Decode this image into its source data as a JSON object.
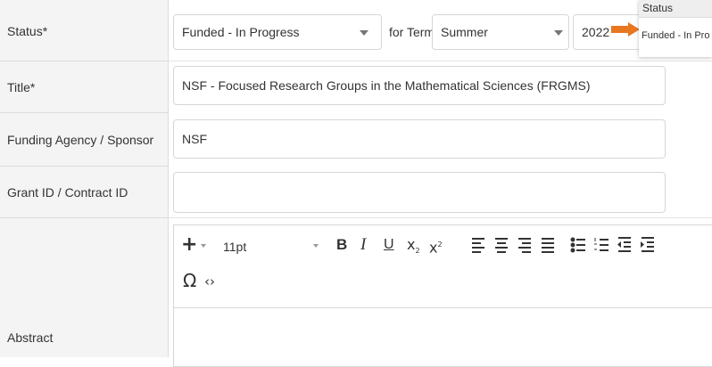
{
  "fields": {
    "status_label": "Status*",
    "title_label": "Title*",
    "funding_label": "Funding Agency / Sponsor",
    "grant_label": "Grant ID / Contract ID",
    "abstract_label": "Abstract"
  },
  "status": {
    "value": "Funded - In Progress",
    "term_connector": "for Term",
    "term_value": "Summer",
    "year_value": "2022"
  },
  "title_value": "NSF - Focused Research Groups in the Mathematical Sciences (FRGMS)",
  "funding_value": "NSF",
  "grant_value": "",
  "editor": {
    "font_size": "11pt",
    "toolbar": {
      "insert": "+",
      "bold": "B",
      "italic": "I",
      "underline": "U",
      "subscript": "x",
      "superscript": "x",
      "omega": "Ω",
      "code": "‹›"
    },
    "content": ""
  },
  "tooltip": {
    "header": "Status",
    "text": "Funded - In Pro"
  },
  "colors": {
    "arrow": "#e87722",
    "label_bg": "#f4f4f4",
    "border": "#d6d6d6"
  }
}
